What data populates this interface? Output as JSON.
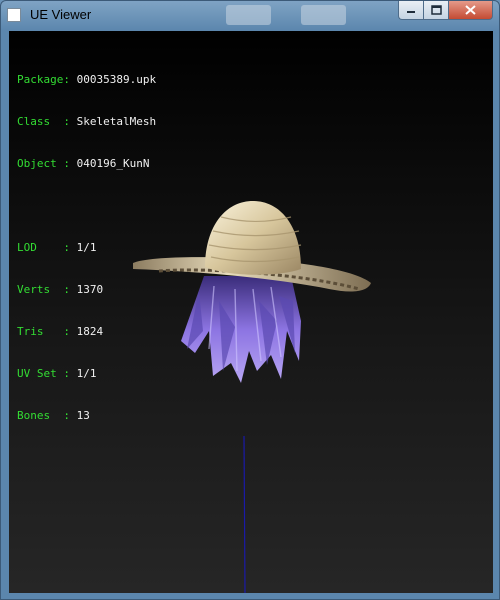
{
  "window": {
    "title": "UE Viewer"
  },
  "info": {
    "package": {
      "label": "Package",
      "value": "00035389.upk"
    },
    "class": {
      "label": "Class",
      "value": "SkeletalMesh"
    },
    "object": {
      "label": "Object",
      "value": "040196_KunN"
    },
    "lod": {
      "label": "LOD",
      "value": "1/1"
    },
    "verts": {
      "label": "Verts",
      "value": "1370"
    },
    "tris": {
      "label": "Tris",
      "value": "1824"
    },
    "uvset": {
      "label": "UV Set",
      "value": "1/1"
    },
    "bones": {
      "label": "Bones",
      "value": "13"
    }
  },
  "colors": {
    "label": "#33dd33",
    "value": "#f0f0f0",
    "axis": "#1a1aa8",
    "hair": "#8a6ad8",
    "hat": "#d8c8a0"
  }
}
